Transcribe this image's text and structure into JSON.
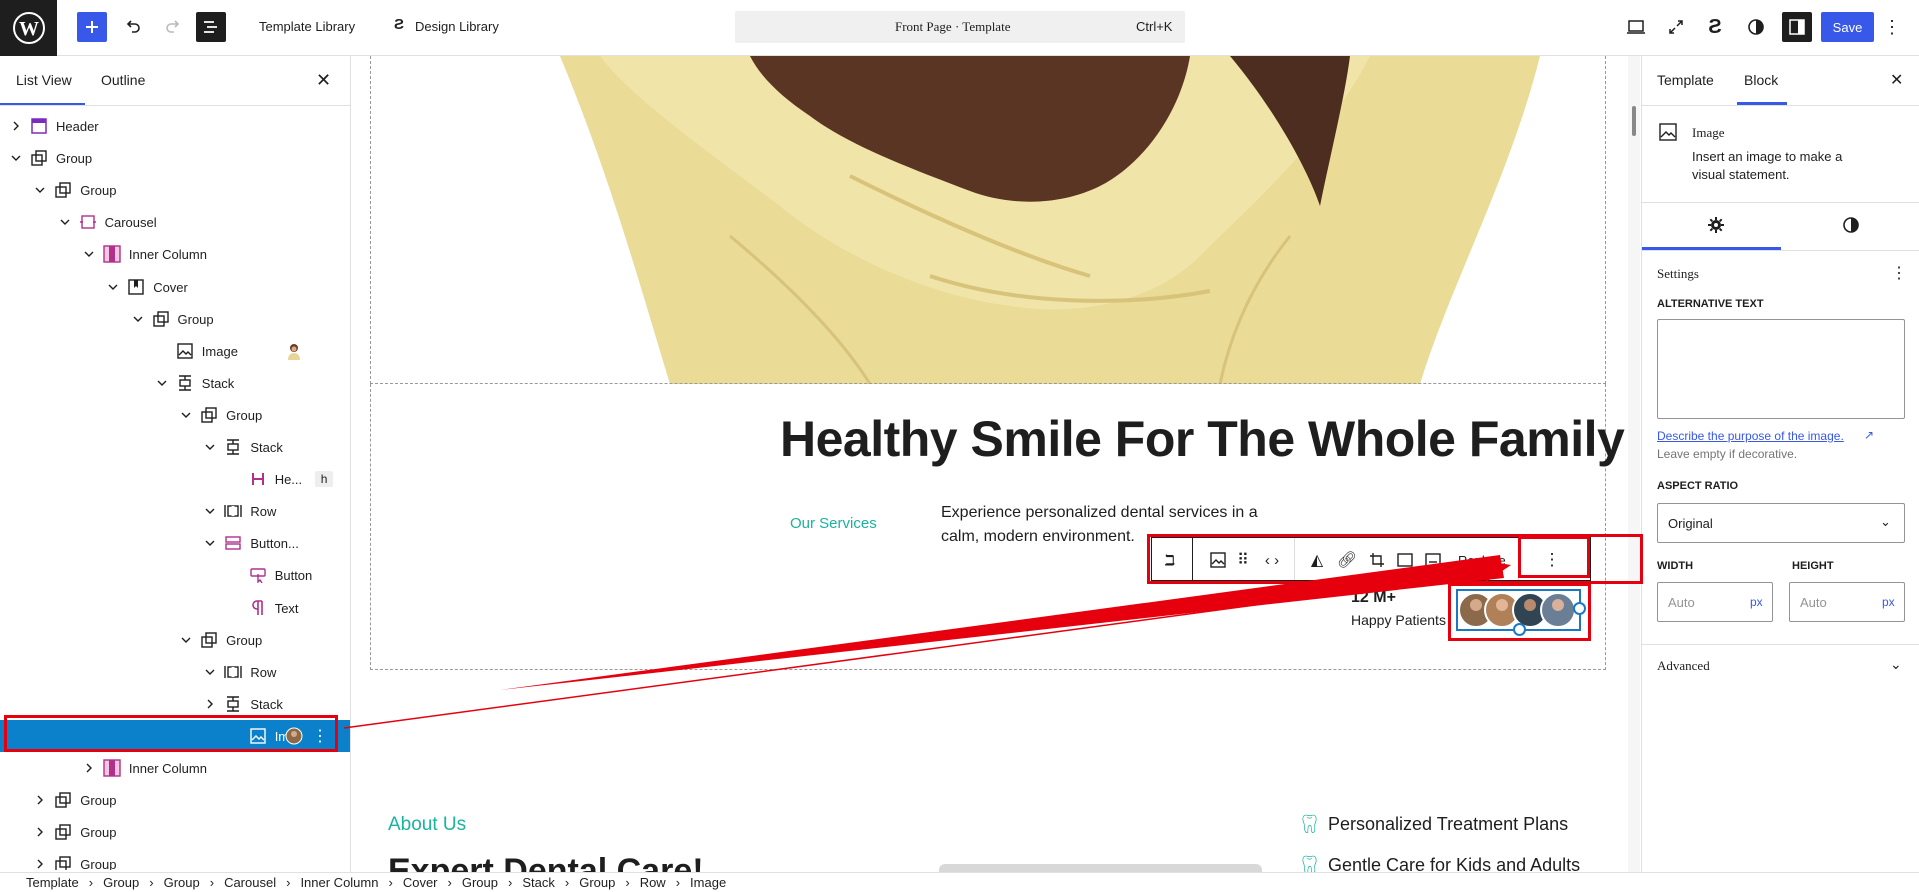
{
  "topbar": {
    "template_library": "Template Library",
    "design_library": "Design Library",
    "doc_title": "Front Page · Template",
    "shortcut": "Ctrl+K",
    "save": "Save"
  },
  "left_panel": {
    "tabs": [
      "List View",
      "Outline"
    ],
    "tree": [
      {
        "label": "Header",
        "depth": 0,
        "chev": "right",
        "icon": "header-icon"
      },
      {
        "label": "Group",
        "depth": 0,
        "chev": "down",
        "icon": "group-icon"
      },
      {
        "label": "Group",
        "depth": 1,
        "chev": "down",
        "icon": "group-icon"
      },
      {
        "label": "Carousel",
        "depth": 2,
        "chev": "down",
        "icon": "carousel-icon"
      },
      {
        "label": "Inner Column",
        "depth": 3,
        "chev": "down",
        "icon": "column-icon"
      },
      {
        "label": "Cover",
        "depth": 4,
        "chev": "down",
        "icon": "cover-icon"
      },
      {
        "label": "Group",
        "depth": 5,
        "chev": "down",
        "icon": "group-icon"
      },
      {
        "label": "Image",
        "depth": 6,
        "chev": "none",
        "icon": "image-icon",
        "thumb": "woman"
      },
      {
        "label": "Stack",
        "depth": 6,
        "chev": "down",
        "icon": "stack-icon"
      },
      {
        "label": "Group",
        "depth": 7,
        "chev": "down",
        "icon": "group-icon"
      },
      {
        "label": "Stack",
        "depth": 8,
        "chev": "down",
        "icon": "stack-icon"
      },
      {
        "label": "He...",
        "depth": 9,
        "chev": "none",
        "icon": "heading-icon",
        "badge": "h"
      },
      {
        "label": "Row",
        "depth": 8,
        "chev": "down",
        "icon": "row-icon"
      },
      {
        "label": "Button...",
        "depth": 8,
        "chev": "down",
        "icon": "buttons-icon"
      },
      {
        "label": "Button",
        "depth": 9,
        "chev": "none",
        "icon": "button-icon"
      },
      {
        "label": "Text",
        "depth": 9,
        "chev": "none",
        "icon": "paragraph-icon"
      },
      {
        "label": "Group",
        "depth": 7,
        "chev": "down",
        "icon": "group-icon"
      },
      {
        "label": "Row",
        "depth": 8,
        "chev": "down",
        "icon": "row-icon"
      },
      {
        "label": "Stack",
        "depth": 8,
        "chev": "right",
        "icon": "stack-icon"
      },
      {
        "label": "Im...",
        "depth": 9,
        "chev": "none",
        "icon": "image-icon",
        "selected": true,
        "thumb": "avatars"
      },
      {
        "label": "Inner Column",
        "depth": 3,
        "chev": "right",
        "icon": "column-icon"
      },
      {
        "label": "Group",
        "depth": 1,
        "chev": "right",
        "icon": "group-icon"
      },
      {
        "label": "Group",
        "depth": 1,
        "chev": "right",
        "icon": "group-icon"
      },
      {
        "label": "Group",
        "depth": 1,
        "chev": "right",
        "icon": "group-icon"
      }
    ]
  },
  "canvas": {
    "hero_heading": "Healthy Smile For The Whole Family",
    "services_link": "Our Services",
    "description": "Experience personalized dental services in a calm, modern environment.",
    "stat_number": "12 M+",
    "stat_label": "Happy Patients",
    "replace": "Replace",
    "about_us": "About Us",
    "expert_heading": "Expert Dental Care!",
    "features": [
      "Personalized Treatment Plans",
      "Gentle Care for Kids and Adults"
    ]
  },
  "right_panel": {
    "tabs": [
      "Template",
      "Block"
    ],
    "block_name": "Image",
    "block_desc": "Insert an image to make a visual statement.",
    "settings_label": "Settings",
    "alt_label": "ALTERNATIVE TEXT",
    "alt_link": "Describe the purpose of the image.",
    "alt_help": "Leave empty if decorative.",
    "aspect_label": "ASPECT RATIO",
    "aspect_value": "Original",
    "width_label": "WIDTH",
    "height_label": "HEIGHT",
    "width_placeholder": "Auto",
    "height_placeholder": "Auto",
    "unit": "px",
    "advanced": "Advanced"
  },
  "breadcrumb": [
    "Template",
    "Group",
    "Group",
    "Carousel",
    "Inner Column",
    "Cover",
    "Group",
    "Stack",
    "Group",
    "Row",
    "Image"
  ],
  "colors": {
    "accent": "#3858e9",
    "selected": "#0b80cb",
    "highlight": "#e6000e",
    "teal": "#1ab39f"
  }
}
